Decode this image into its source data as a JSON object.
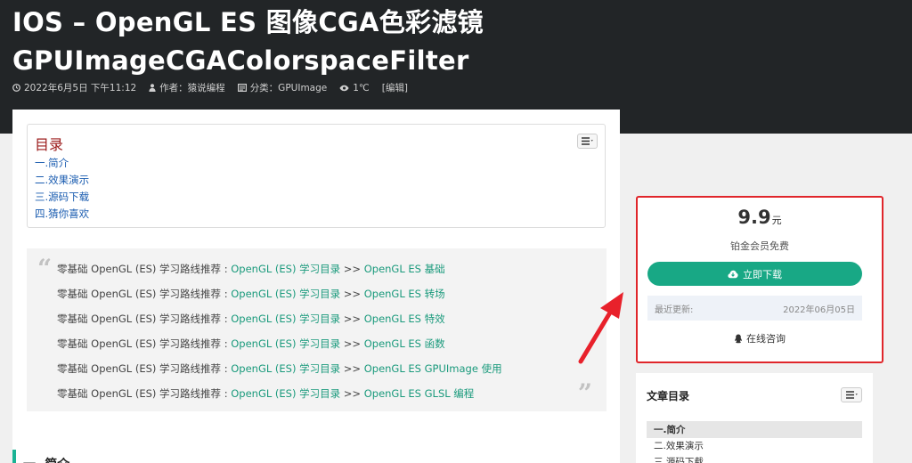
{
  "article": {
    "title_line1": "IOS  –  OpenGL ES 图像CGA色彩滤镜",
    "title_line2": "GPUImageCGAColorspaceFilter",
    "meta": {
      "date": "2022年6月5日 下午11:12",
      "author": "作者：猿说编程",
      "category": "分类：GPUImage",
      "views": "1℃",
      "edit": "[编辑]"
    }
  },
  "toc": {
    "title": "目录",
    "items": [
      "一.简介",
      "二.效果演示",
      "三.源码下载",
      "四.猜你喜欢"
    ]
  },
  "quote": {
    "open_mark": "“",
    "close_mark": "”",
    "lines": [
      {
        "prefix": "零基础 OpenGL (ES) 学习路线推荐 : ",
        "link1": "OpenGL (ES) 学习目录",
        "sep": " >> ",
        "link2": "OpenGL ES 基础"
      },
      {
        "prefix": "零基础 OpenGL (ES) 学习路线推荐 : ",
        "link1": "OpenGL (ES) 学习目录",
        "sep": " >> ",
        "link2": "OpenGL ES 转场"
      },
      {
        "prefix": "零基础 OpenGL (ES) 学习路线推荐 : ",
        "link1": "OpenGL (ES) 学习目录",
        "sep": " >> ",
        "link2": "OpenGL ES 特效"
      },
      {
        "prefix": "零基础 OpenGL (ES) 学习路线推荐 : ",
        "link1": "OpenGL (ES) 学习目录",
        "sep": " >> ",
        "link2": "OpenGL ES 函数"
      },
      {
        "prefix": "零基础 OpenGL (ES) 学习路线推荐 : ",
        "link1": "OpenGL (ES) 学习目录",
        "sep": " >> ",
        "link2": "OpenGL ES GPUImage 使用"
      },
      {
        "prefix": "零基础 OpenGL (ES) 学习路线推荐 : ",
        "link1": "OpenGL (ES) 学习目录",
        "sep": " >> ",
        "link2": "OpenGL ES GLSL 编程"
      }
    ]
  },
  "section": {
    "heading": "一. 简介"
  },
  "download": {
    "price": "9.9",
    "unit": "元",
    "vip_note": "铂金会员免费",
    "button_label": "立即下载",
    "updated_label": "最近更新:",
    "updated_value": "2022年06月05日",
    "consult_label": "在线咨询"
  },
  "side_toc": {
    "title": "文章目录",
    "items": [
      "一.简介",
      "二.效果演示",
      "三.源码下载"
    ]
  },
  "colors": {
    "accent": "#18a885",
    "highlight_border": "#e0262b",
    "arrow": "#e8212b",
    "link": "#1a9a7c"
  }
}
